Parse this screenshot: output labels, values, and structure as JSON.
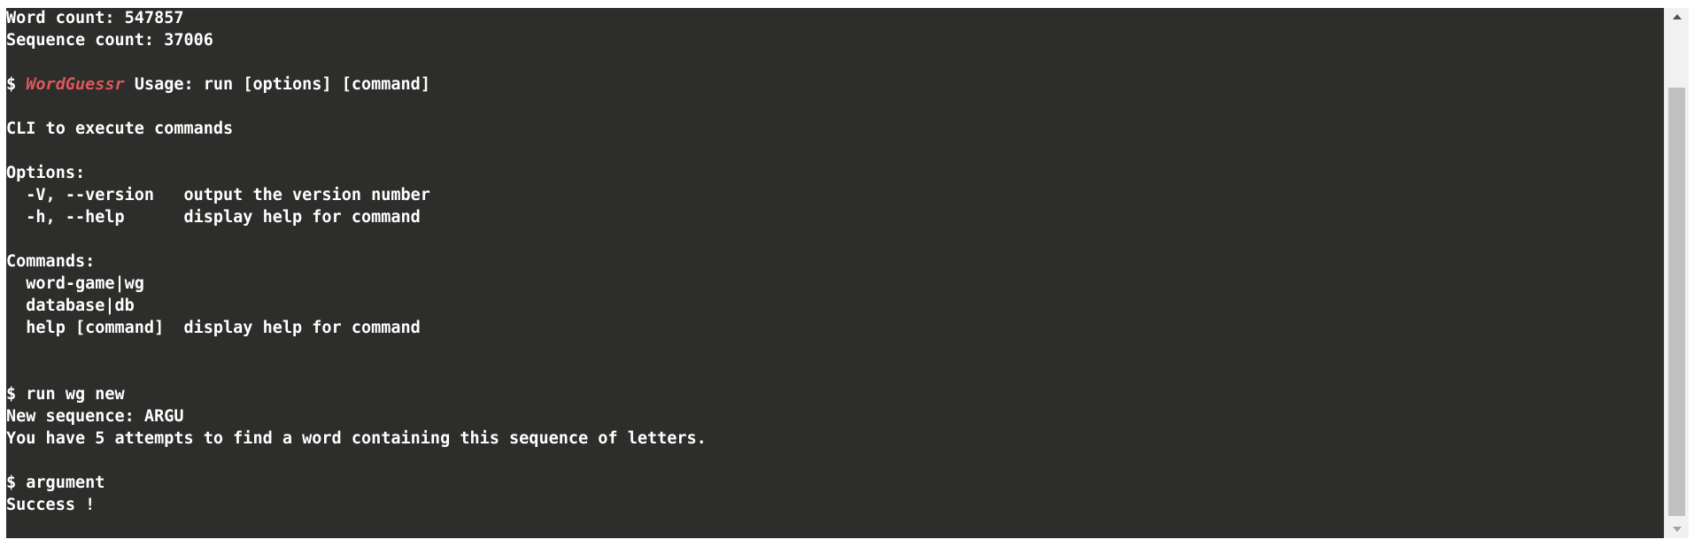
{
  "terminal": {
    "prompt": "$",
    "brand": "WordGuessr",
    "lines": {
      "word_count": "Word count: 547857",
      "sequence_count": "Sequence count: 37006",
      "usage": "Usage: run [options] [command]",
      "description": "CLI to execute commands",
      "options_header": "Options:",
      "option_version": "  -V, --version   output the version number",
      "option_help": "  -h, --help      display help for command",
      "commands_header": "Commands:",
      "command_word_game": "  word-game|wg",
      "command_database": "  database|db",
      "command_help": "  help [command]  display help for command",
      "cmd_run_new": "run wg new",
      "new_sequence": "New sequence: ARGU",
      "attempts_info": "You have 5 attempts to find a word containing this sequence of letters.",
      "cmd_answer": "argument",
      "result": "Success !"
    }
  },
  "scrollbar": {
    "up_icon": "triangle-up-icon",
    "down_icon": "triangle-down-icon"
  }
}
